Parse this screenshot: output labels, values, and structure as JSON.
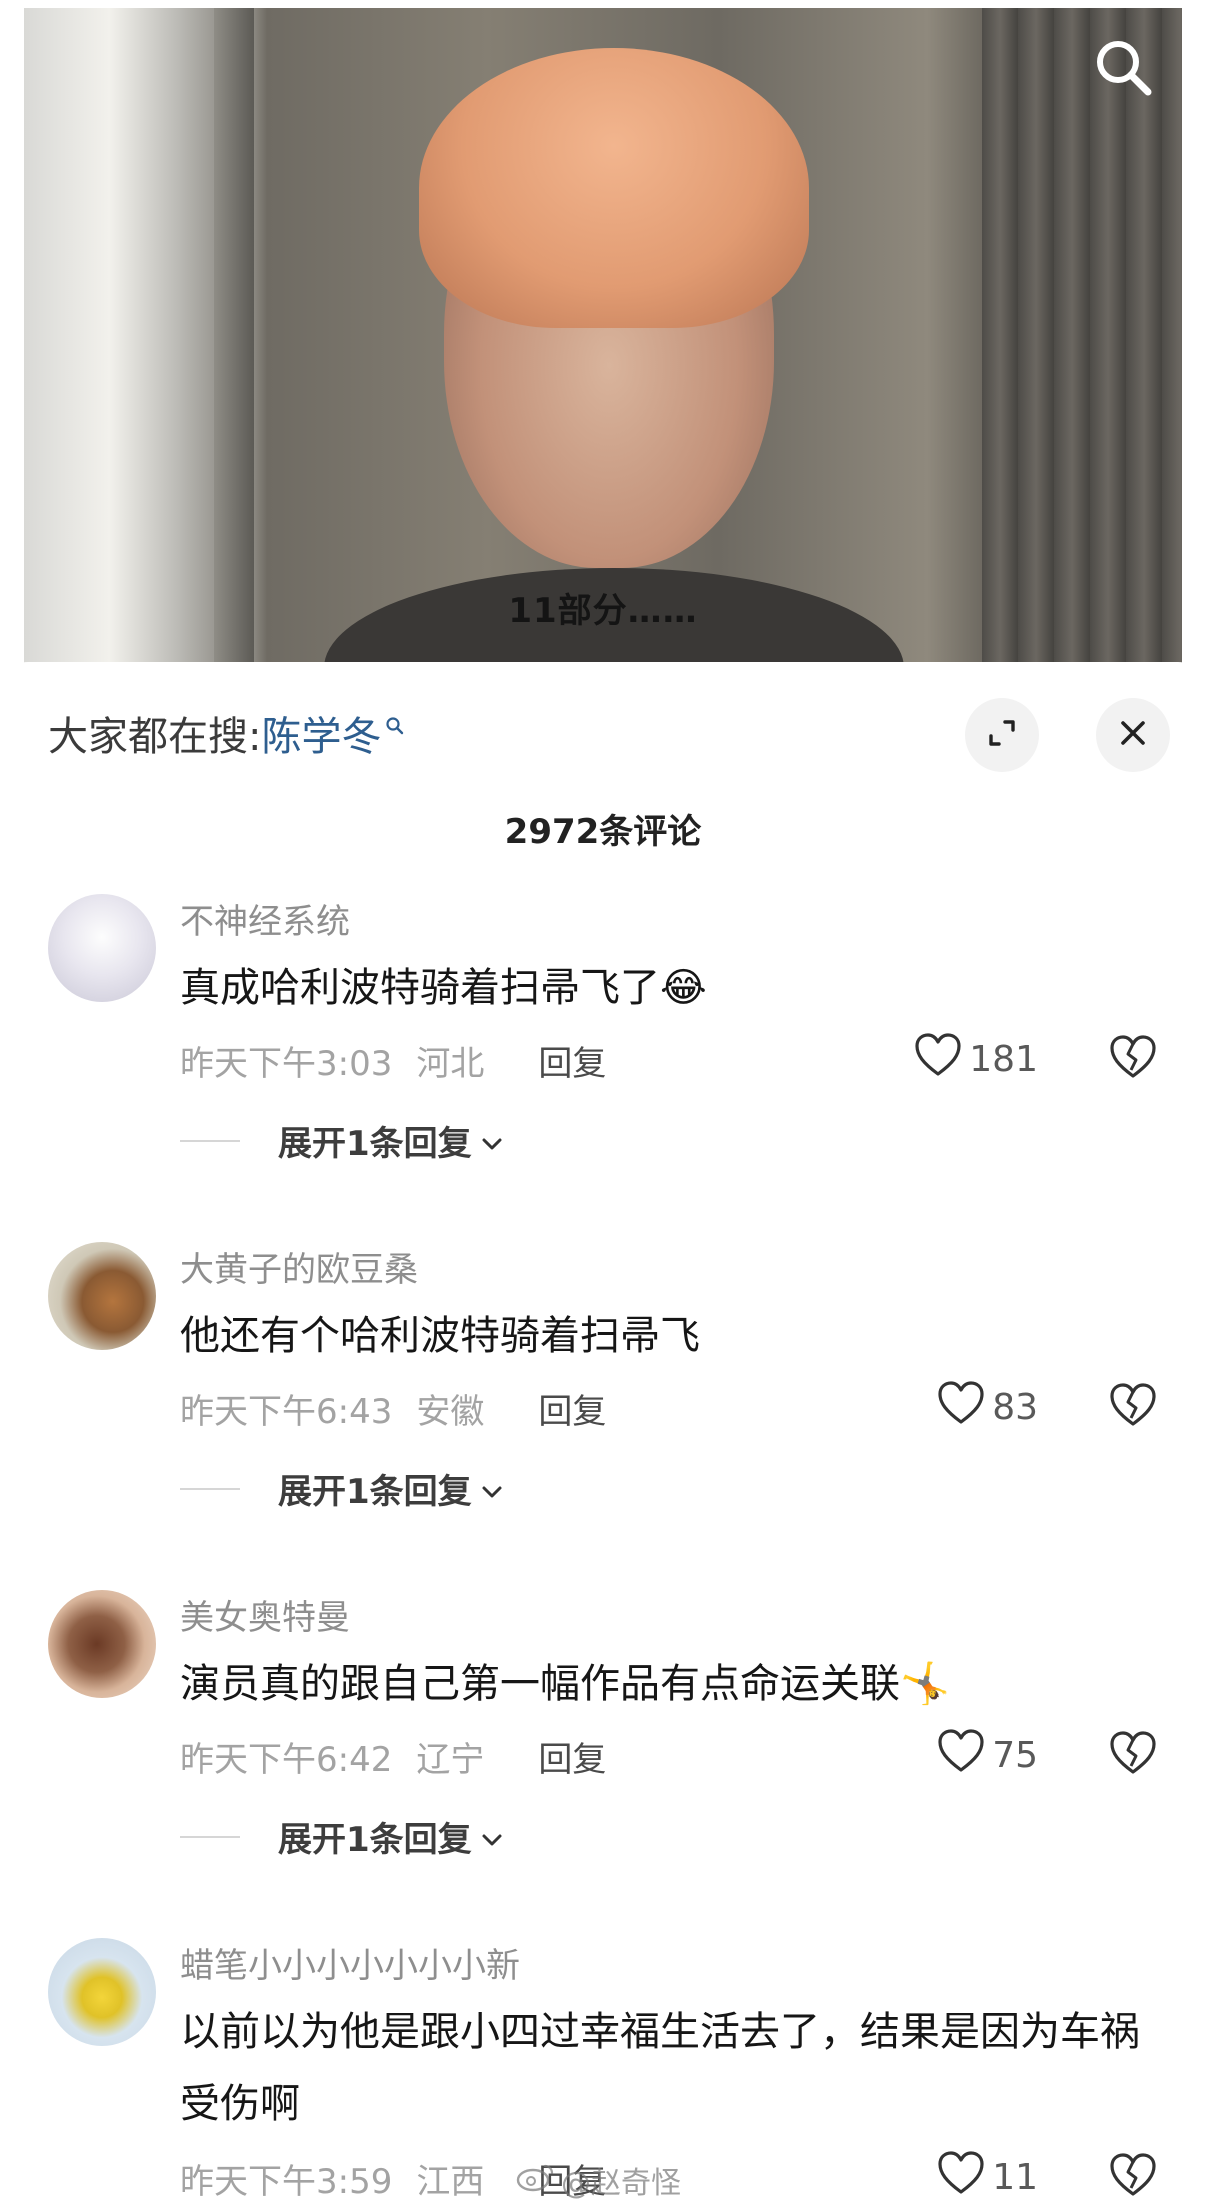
{
  "video": {
    "subtitle": "11部分……"
  },
  "sheet": {
    "hot_search_prefix": "大家都在搜:",
    "hot_search_keyword": "陈学冬",
    "comment_count": "2972条评论"
  },
  "comments": [
    {
      "username": "不神经系统",
      "text": "真成哈利波特骑着扫帚飞了",
      "emoji": "😂",
      "time": "昨天下午3:03",
      "location": "河北",
      "reply_label": "回复",
      "likes": "181",
      "expand_label": "展开1条回复"
    },
    {
      "username": "大黄子的欧豆桑",
      "text": "他还有个哈利波特骑着扫帚飞",
      "emoji": "",
      "time": "昨天下午6:43",
      "location": "安徽",
      "reply_label": "回复",
      "likes": "83",
      "expand_label": "展开1条回复"
    },
    {
      "username": "美女奥特曼",
      "text": "演员真的跟自己第一幅作品有点命运关联",
      "emoji": "🤸",
      "time": "昨天下午6:42",
      "location": "辽宁",
      "reply_label": "回复",
      "likes": "75",
      "expand_label": "展开1条回复"
    },
    {
      "username": "蜡笔小小小小小小小新",
      "text": "以前以为他是跟小四过幸福生活去了，结果是因为车祸受伤啊",
      "emoji": "",
      "time": "昨天下午3:59",
      "location": "江西",
      "reply_label": "回复",
      "likes": "11",
      "expand_label": ""
    }
  ],
  "watermark": {
    "text": "@赵奇怪"
  },
  "icons": {
    "search": "search-icon",
    "expand": "expand-icon",
    "close": "close-icon",
    "like": "heart-icon",
    "dislike": "broken-heart-icon",
    "chevron": "chevron-down-icon"
  },
  "colors": {
    "keyword": "#2e5e8f",
    "username": "#8e8e8e",
    "meta": "#a3a3a3"
  }
}
